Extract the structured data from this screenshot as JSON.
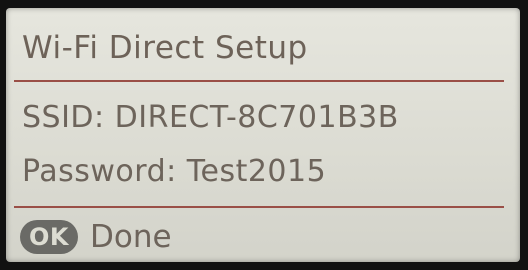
{
  "screen": {
    "title": "Wi-Fi Direct Setup",
    "ssid_line": "SSID: DIRECT-8C701B3B",
    "password_line": "Password: Test2015",
    "ok_icon_label": "OK",
    "done_label": "Done"
  },
  "colors": {
    "lcd_background": "#dcdcd3",
    "text": "#6d645b",
    "divider": "#9a4f47",
    "ok_badge": "#6a6a66"
  },
  "icons": {
    "ok": "ok-button-icon"
  }
}
